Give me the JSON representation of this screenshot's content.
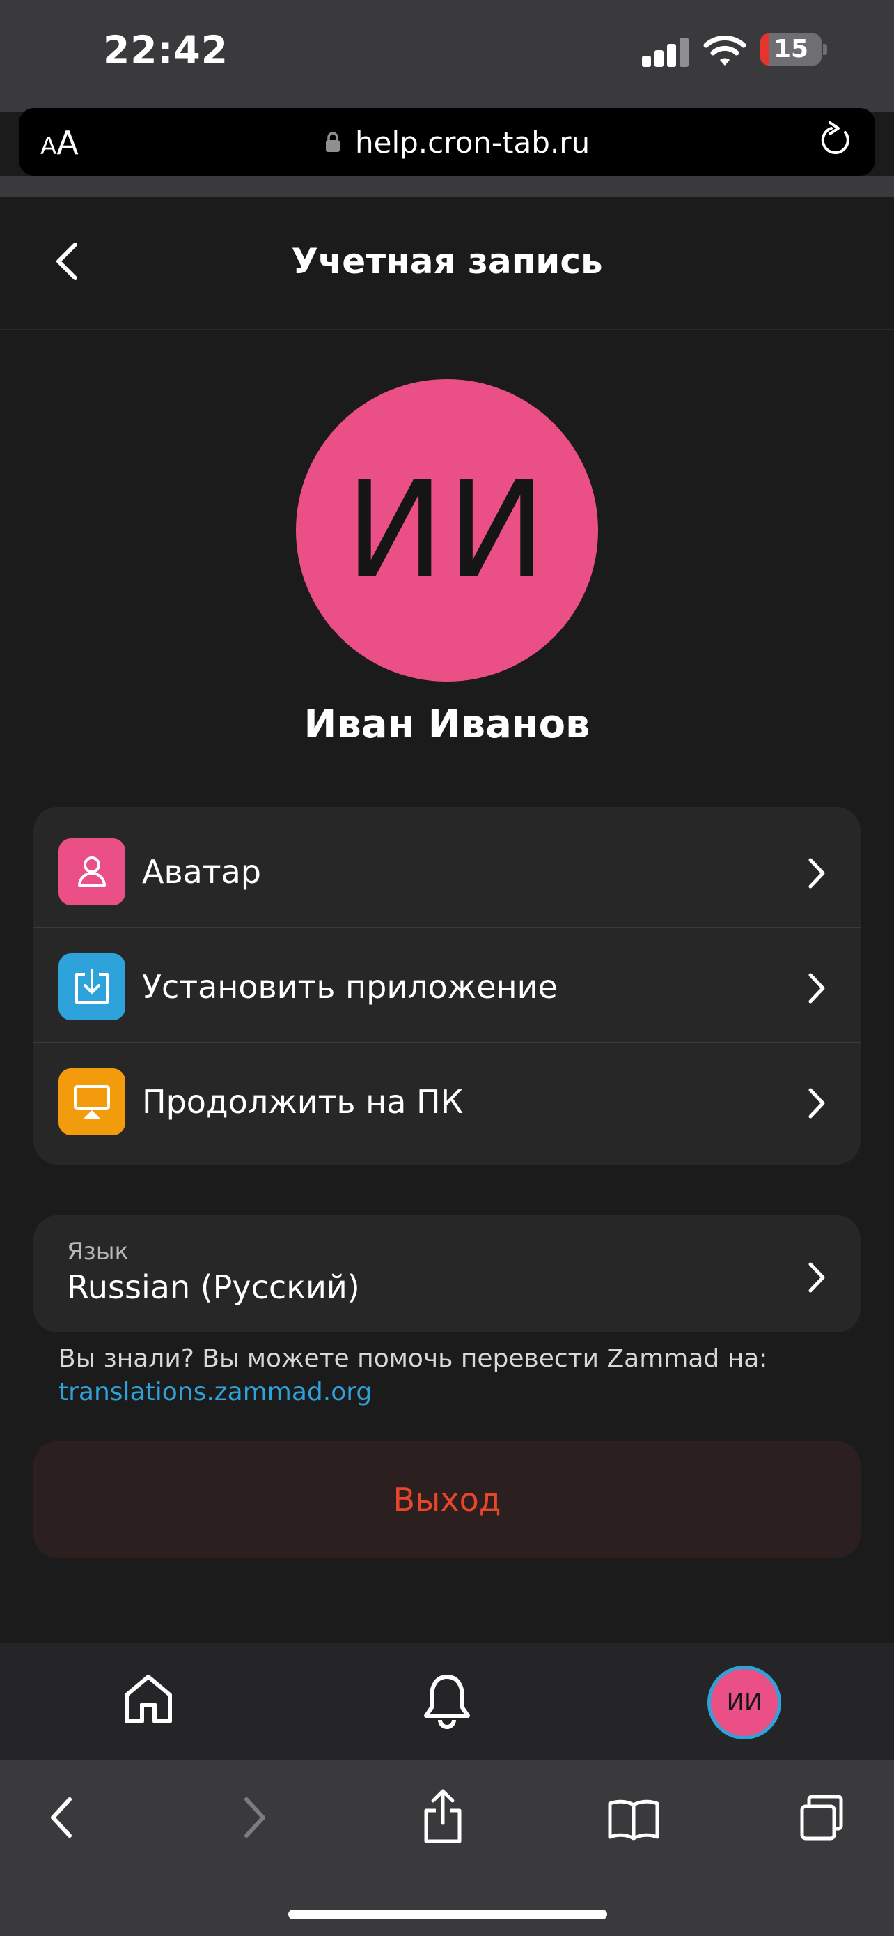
{
  "status_bar": {
    "time": "22:42",
    "battery_percent": "15",
    "battery_level": 0.15
  },
  "browser": {
    "text_size_label": "AA",
    "url": "help.cron-tab.ru"
  },
  "header": {
    "title": "Учетная запись"
  },
  "profile": {
    "initials": "ИИ",
    "name": "Иван Иванов"
  },
  "menu": {
    "items": [
      {
        "label": "Аватар",
        "icon": "user-icon",
        "color": "#ea4f86"
      },
      {
        "label": "Установить приложение",
        "icon": "download-icon",
        "color": "#2ea3db"
      },
      {
        "label": "Продолжить на ПК",
        "icon": "desktop-icon",
        "color": "#f29b0c"
      }
    ]
  },
  "language": {
    "caption": "Язык",
    "value": "Russian (Русский)"
  },
  "hint": {
    "text": "Вы знали? Вы можете помочь перевести Zammad на:",
    "link": "translations.zammad.org"
  },
  "logout": {
    "label": "Выход"
  },
  "bottom_nav": {
    "items": [
      "home-icon",
      "bell-icon",
      "avatar"
    ],
    "avatar_initials": "ИИ"
  },
  "safari_toolbar": {
    "items": [
      "back-icon",
      "forward-icon",
      "share-icon",
      "bookmarks-icon",
      "tabs-icon"
    ]
  },
  "colors": {
    "accent_pink": "#ea4f86",
    "accent_blue": "#2ea3db",
    "accent_orange": "#f29b0c",
    "danger": "#e8462b"
  }
}
